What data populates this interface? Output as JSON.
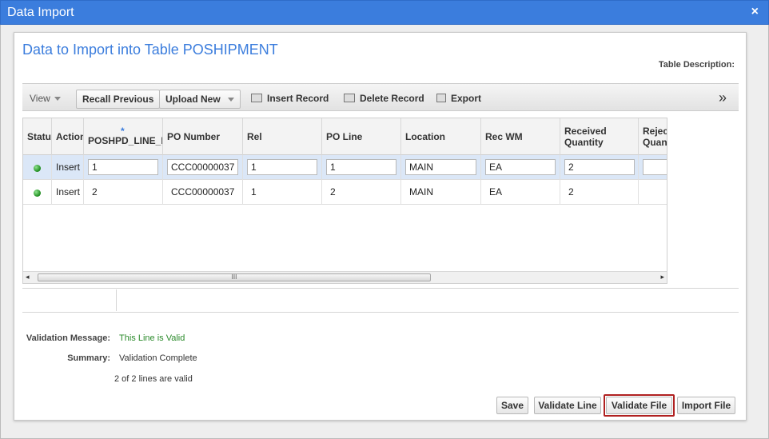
{
  "window": {
    "title": "Data Import",
    "close_glyph": "×"
  },
  "panel": {
    "heading": "Data to Import into Table POSHIPMENT",
    "table_description_label": "Table Description:"
  },
  "toolbar": {
    "view": "View",
    "recall_previous": "Recall Previous",
    "upload_new": "Upload New",
    "insert_record": "Insert Record",
    "delete_record": "Delete Record",
    "export": "Export",
    "more": "»"
  },
  "grid": {
    "required_marker": "*",
    "columns": [
      "Status",
      "Action",
      "POSHPD_LINE_NUMBER",
      "PO Number",
      "Rel",
      "PO Line",
      "Location",
      "Rec WM",
      "Received",
      "Quantity",
      "Rejected",
      "Quantity"
    ],
    "rows": [
      {
        "action": "Insert",
        "line": "1",
        "po_number": "CCC00000037",
        "rel": "1",
        "po_line": "1",
        "location": "MAIN",
        "rec_wm": "EA",
        "received_qty": "2",
        "rejected_qty": ""
      },
      {
        "action": "Insert",
        "line": "2",
        "po_number": "CCC00000037",
        "rel": "1",
        "po_line": "2",
        "location": "MAIN",
        "rec_wm": "EA",
        "received_qty": "2",
        "rejected_qty": ""
      }
    ],
    "scroll_grip": "III"
  },
  "validation": {
    "message_label": "Validation Message:",
    "message_value": "This Line is Valid",
    "summary_label": "Summary:",
    "summary_value": "Validation Complete",
    "lines_valid": "2 of 2 lines are valid"
  },
  "buttons": {
    "save": "Save",
    "validate_line": "Validate Line",
    "validate_file": "Validate File",
    "import_file": "Import File"
  },
  "colors": {
    "title_bar": "#3b7ddd",
    "valid_text": "#2a8a2a",
    "highlight": "#b02020"
  }
}
